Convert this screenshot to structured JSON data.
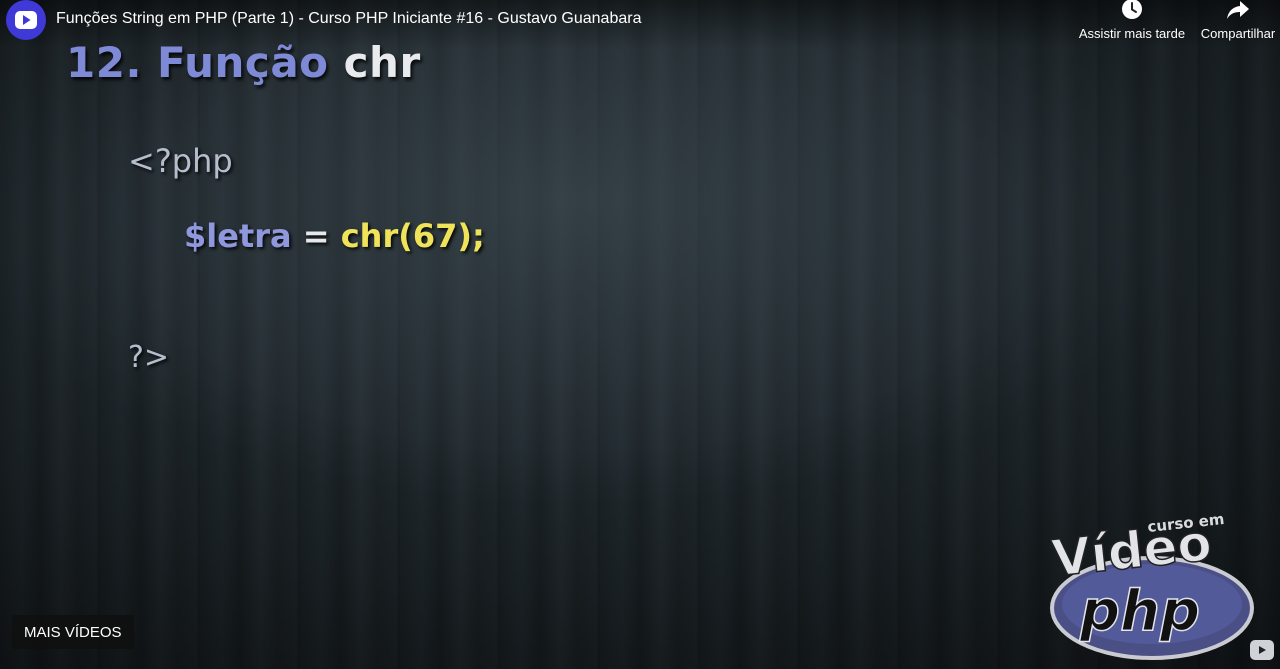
{
  "video": {
    "title": "Funções String em PHP (Parte 1) - Curso PHP Iniciante #16 - Gustavo Guanabara"
  },
  "actions": {
    "watch_later": {
      "label": "Assistir mais tarde",
      "icon": "clock-icon"
    },
    "share": {
      "label": "Compartilhar",
      "icon": "share-arrow-icon"
    }
  },
  "slide": {
    "title_prefix": "12. Função",
    "title_func": "chr",
    "code": {
      "open_tag": "<?php",
      "var": "$letra",
      "op": "=",
      "call": "chr(67);",
      "close_tag": "?>"
    }
  },
  "bottom": {
    "more_videos": "MAIS VÍDEOS"
  },
  "logo": {
    "small": "curso em",
    "big": "Vídeo",
    "php": "php"
  },
  "colors": {
    "title_blue": "#7f8ad6",
    "code_yellow": "#efe35a",
    "avatar_blue": "#3f39d8"
  }
}
